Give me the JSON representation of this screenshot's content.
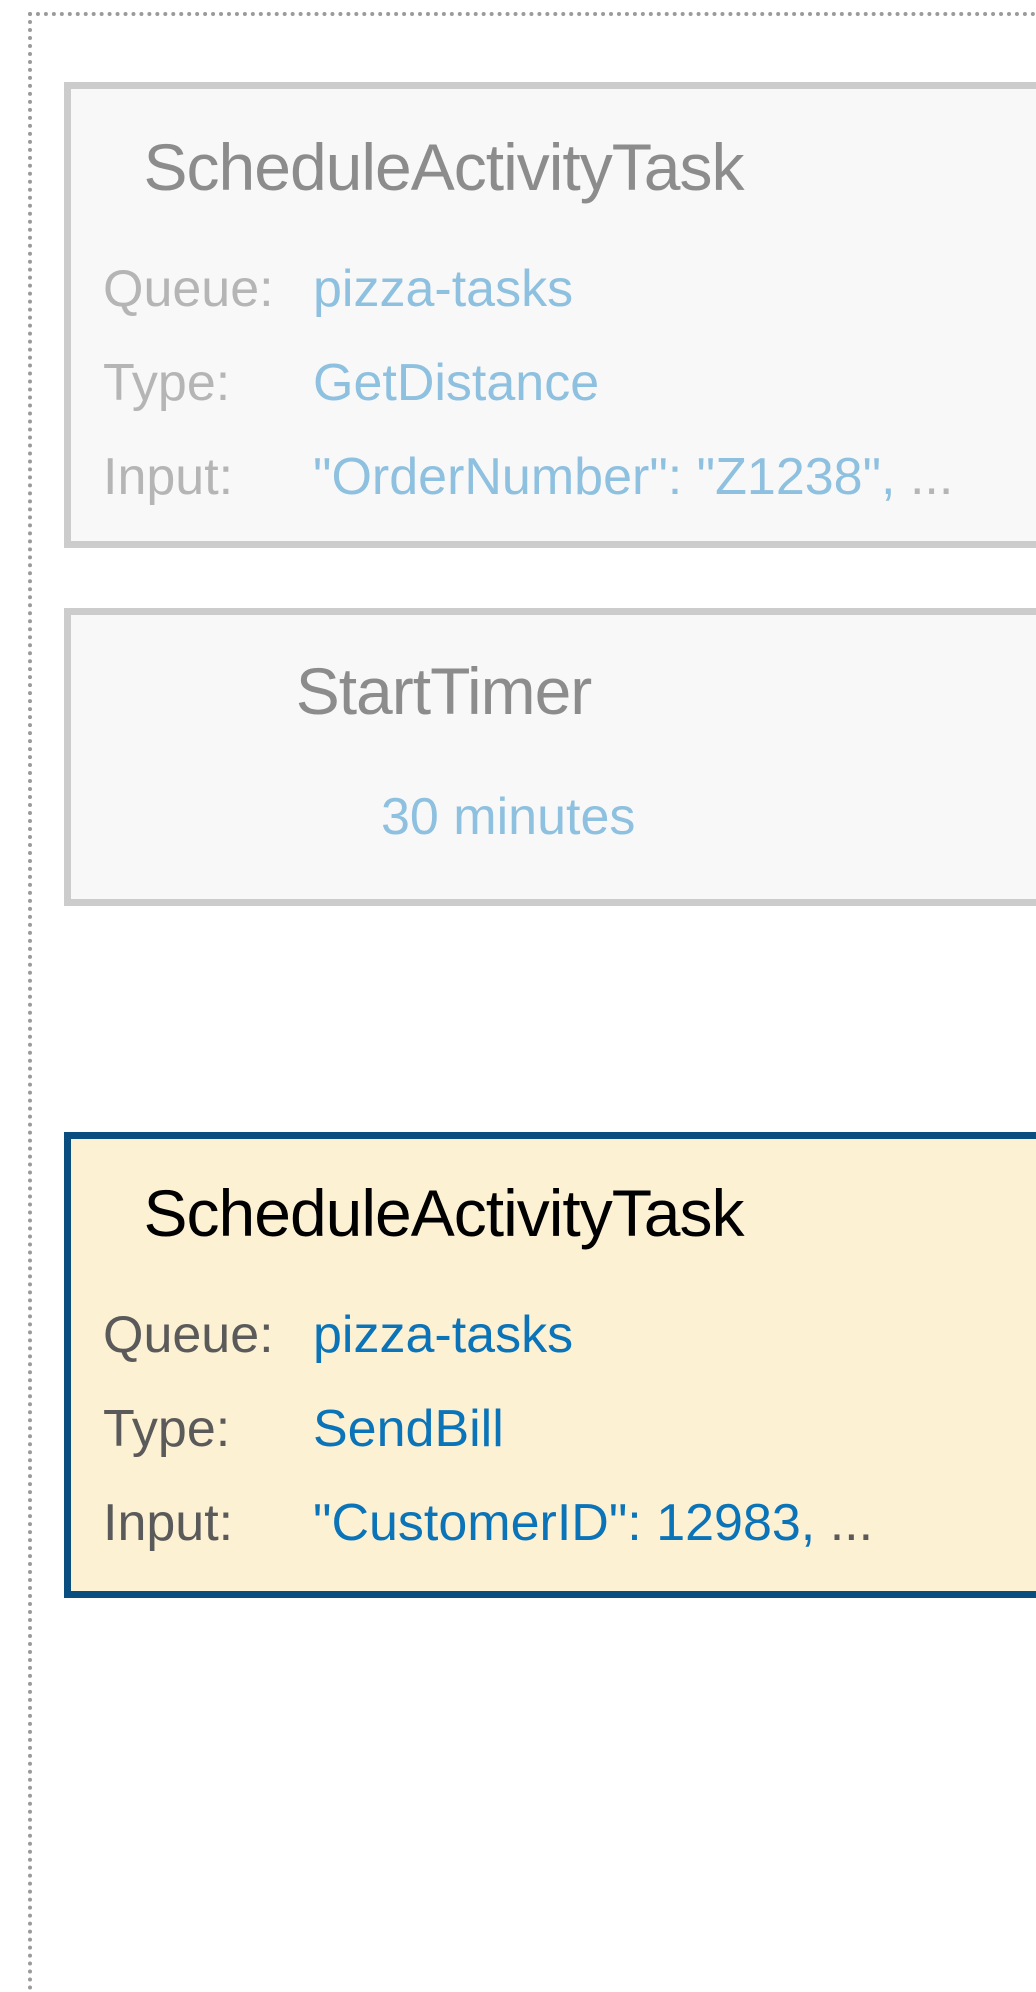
{
  "cards": [
    {
      "title": "ScheduleActivityTask",
      "rows": [
        {
          "label": "Queue:",
          "value": "pizza-tasks",
          "suffix": ""
        },
        {
          "label": "Type:",
          "value": "GetDistance",
          "suffix": ""
        },
        {
          "label": "Input:",
          "value": "\"OrderNumber\": \"Z1238\",",
          "suffix": " ..."
        }
      ]
    },
    {
      "title": "StartTimer",
      "value": "30 minutes"
    },
    {
      "title": "ScheduleActivityTask",
      "rows": [
        {
          "label": "Queue:",
          "value": "pizza-tasks",
          "suffix": ""
        },
        {
          "label": "Type:",
          "value": "SendBill",
          "suffix": ""
        },
        {
          "label": "Input:",
          "value": "\"CustomerID\": 12983,",
          "suffix": " ..."
        }
      ]
    }
  ],
  "colors": {
    "frame_border": "#9b9b9b",
    "muted_card_bg": "#f8f8f8",
    "muted_card_border": "#cccccc",
    "active_card_bg": "#fdf1d4",
    "active_card_border": "#0a4e80",
    "muted_value": "#8ec0df",
    "active_value": "#0b73b8"
  }
}
